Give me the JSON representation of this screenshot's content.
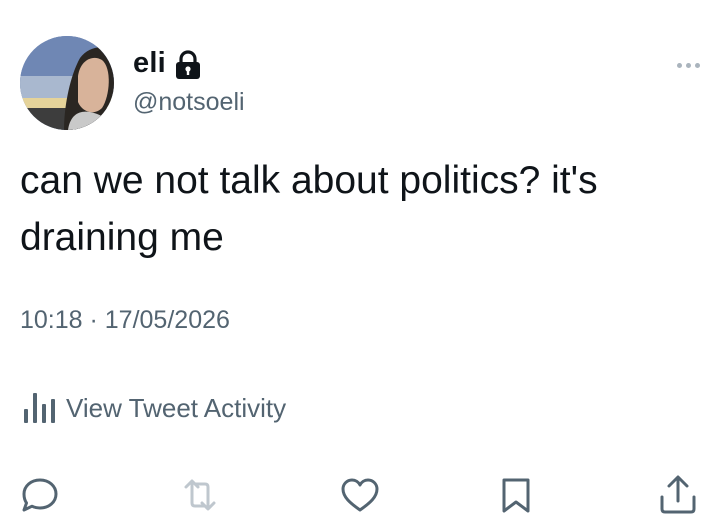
{
  "author": {
    "display_name": "eli",
    "handle": "@notsoeli",
    "protected_icon": "lock-icon",
    "avatar": "avatar-photo"
  },
  "tweet": {
    "text": "can we not talk about politics? it's draining me",
    "timestamp": "10:18 · 17/05/2026"
  },
  "activity": {
    "icon": "bar-chart-icon",
    "label": "View Tweet Activity"
  },
  "actions": {
    "icons": [
      "reply-icon",
      "retweet-icon",
      "like-icon",
      "bookmark-icon",
      "share-icon"
    ]
  },
  "colors": {
    "text": "#0f1419",
    "secondary": "#536471",
    "icon": "#536471"
  }
}
